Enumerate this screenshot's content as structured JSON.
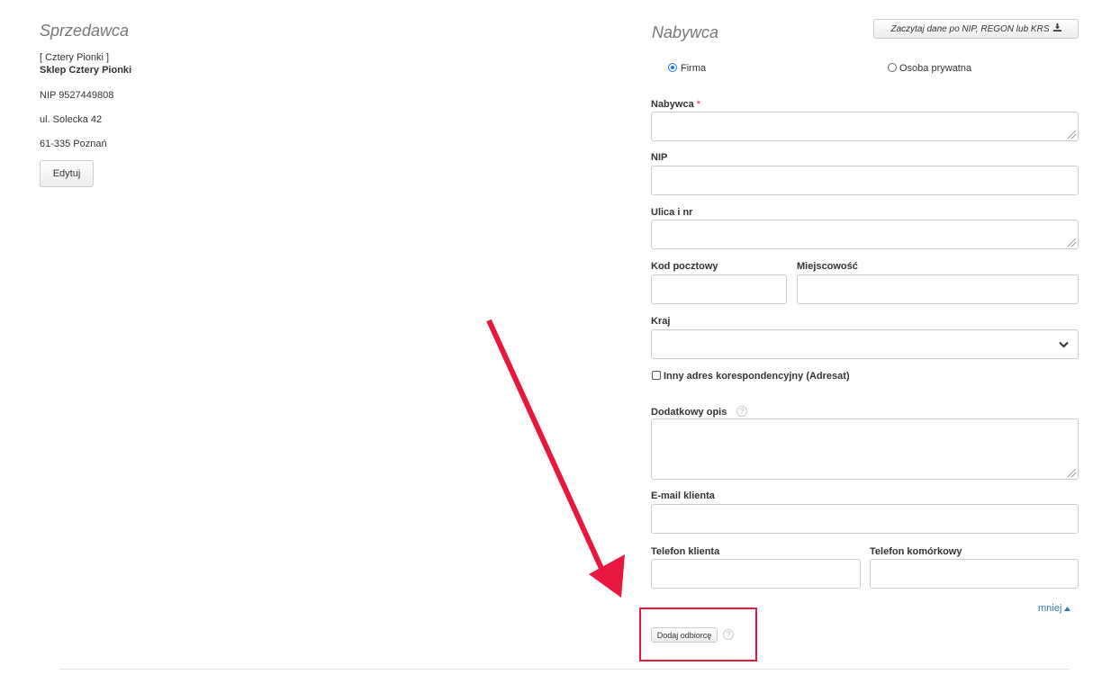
{
  "seller": {
    "title": "Sprzedawca",
    "short_name": "[ Cztery Pionki ]",
    "name": "Sklep Cztery Pionki",
    "nip": "NIP 9527449808",
    "street": "ul. Solecka 42",
    "city": "61-335 Poznań",
    "edit_label": "Edytuj"
  },
  "buyer": {
    "title": "Nabywca",
    "fetch_button_label": "Zaczytaj dane po NIP, REGON lub KRS",
    "fetch_icon": "download-icon",
    "type_options": [
      {
        "label": "Firma",
        "selected": true
      },
      {
        "label": "Osoba prywatna",
        "selected": false
      }
    ],
    "fields": {
      "name_label": "Nabywca",
      "required_mark": "*",
      "name_value": "",
      "nip_label": "NIP",
      "nip_value": "",
      "street_label": "Ulica i nr",
      "street_value": "",
      "postal_label": "Kod pocztowy",
      "postal_value": "",
      "city_label": "Miejscowość",
      "city_value": "",
      "country_label": "Kraj",
      "country_value": "",
      "other_address_label": "Inny adres korespondencyjny (Adresat)",
      "other_address_checked": false,
      "extra_desc_label": "Dodatkowy opis",
      "extra_desc_value": "",
      "email_label": "E-mail klienta",
      "email_value": "",
      "phone_label": "Telefon klienta",
      "phone_value": "",
      "mobile_label": "Telefon komórkowy",
      "mobile_value": ""
    },
    "less_link": "mniej",
    "add_recipient_label": "Dodaj odbiorcę",
    "help_glyph": "?"
  },
  "annotation": {
    "color": "#e8173d"
  }
}
